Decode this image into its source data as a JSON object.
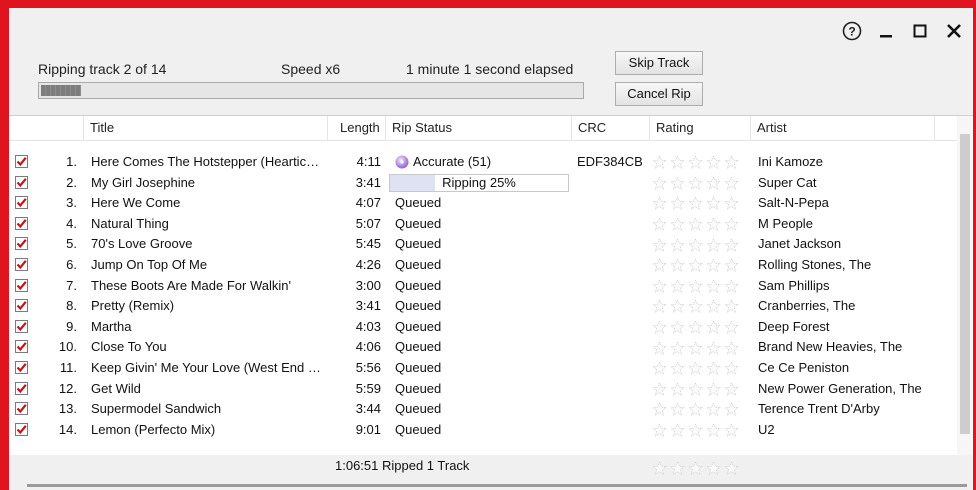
{
  "window": {
    "help_icon": "help-circle-icon",
    "minimize_icon": "minimize-icon",
    "maximize_icon": "maximize-icon",
    "close_icon": "close-icon"
  },
  "status": {
    "ripping_text": "Ripping track 2 of 14",
    "speed_text": "Speed x6",
    "elapsed_text": "1 minute 1 second elapsed",
    "overall_progress": 0.08
  },
  "buttons": {
    "skip_track": "Skip Track",
    "cancel_rip": "Cancel Rip"
  },
  "columns": {
    "title": "Title",
    "length": "Length",
    "rip_status": "Rip Status",
    "crc": "CRC",
    "rating": "Rating",
    "artist": "Artist"
  },
  "tracks": [
    {
      "num": "1.",
      "title": "Here Comes The Hotstepper (Heartic…",
      "length": "4:11",
      "status": "Accurate (51)",
      "crc": "EDF384CB",
      "artist": "Ini Kamoze",
      "checked": true
    },
    {
      "num": "2.",
      "title": "My Girl Josephine",
      "length": "3:41",
      "status": "Ripping 25%",
      "progress": 0.25,
      "crc": "",
      "artist": "Super Cat",
      "checked": true
    },
    {
      "num": "3.",
      "title": "Here We Come",
      "length": "4:07",
      "status": "Queued",
      "crc": "",
      "artist": "Salt-N-Pepa",
      "checked": true
    },
    {
      "num": "4.",
      "title": "Natural Thing",
      "length": "5:07",
      "status": "Queued",
      "crc": "",
      "artist": "M People",
      "checked": true
    },
    {
      "num": "5.",
      "title": "70's Love Groove",
      "length": "5:45",
      "status": "Queued",
      "crc": "",
      "artist": "Janet Jackson",
      "checked": true
    },
    {
      "num": "6.",
      "title": "Jump On Top Of Me",
      "length": "4:26",
      "status": "Queued",
      "crc": "",
      "artist": "Rolling Stones, The",
      "checked": true
    },
    {
      "num": "7.",
      "title": "These Boots Are Made For Walkin'",
      "length": "3:00",
      "status": "Queued",
      "crc": "",
      "artist": "Sam Phillips",
      "checked": true
    },
    {
      "num": "8.",
      "title": "Pretty (Remix)",
      "length": "3:41",
      "status": "Queued",
      "crc": "",
      "artist": "Cranberries, The",
      "checked": true
    },
    {
      "num": "9.",
      "title": "Martha",
      "length": "4:03",
      "status": "Queued",
      "crc": "",
      "artist": "Deep Forest",
      "checked": true
    },
    {
      "num": "10.",
      "title": "Close To You",
      "length": "4:06",
      "status": "Queued",
      "crc": "",
      "artist": "Brand New Heavies, The",
      "checked": true
    },
    {
      "num": "11.",
      "title": "Keep Givin' Me Your Love (West End …",
      "length": "5:56",
      "status": "Queued",
      "crc": "",
      "artist": "Ce Ce Peniston",
      "checked": true
    },
    {
      "num": "12.",
      "title": "Get Wild",
      "length": "5:59",
      "status": "Queued",
      "crc": "",
      "artist": "New Power Generation, The",
      "checked": true
    },
    {
      "num": "13.",
      "title": "Supermodel Sandwich",
      "length": "3:44",
      "status": "Queued",
      "crc": "",
      "artist": "Terence Trent D'Arby",
      "checked": true
    },
    {
      "num": "14.",
      "title": "Lemon (Perfecto Mix)",
      "length": "9:01",
      "status": "Queued",
      "crc": "",
      "artist": "U2",
      "checked": true
    }
  ],
  "footer": {
    "summary": "1:06:51  Ripped 1 Track"
  },
  "colors": {
    "frame": "#e0141e",
    "checkmark": "#c0151b"
  }
}
